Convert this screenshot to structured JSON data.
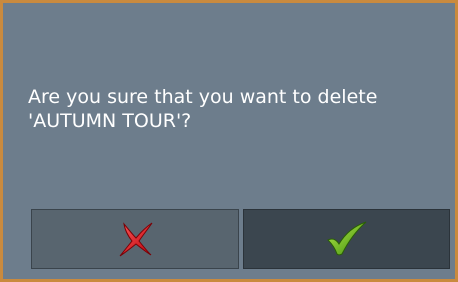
{
  "dialog": {
    "message": "Are you sure that you want to delete\n'AUTUMN TOUR'?",
    "cancel_button": {
      "icon": "red-x-icon",
      "color": "#e0141c"
    },
    "confirm_button": {
      "icon": "green-checkmark-icon",
      "color": "#5cb314"
    }
  },
  "colors": {
    "frame_border": "#c98a3e",
    "background": "#6d7d8c",
    "button_cancel_bg": "#58656f",
    "button_confirm_bg": "#3b464f"
  }
}
